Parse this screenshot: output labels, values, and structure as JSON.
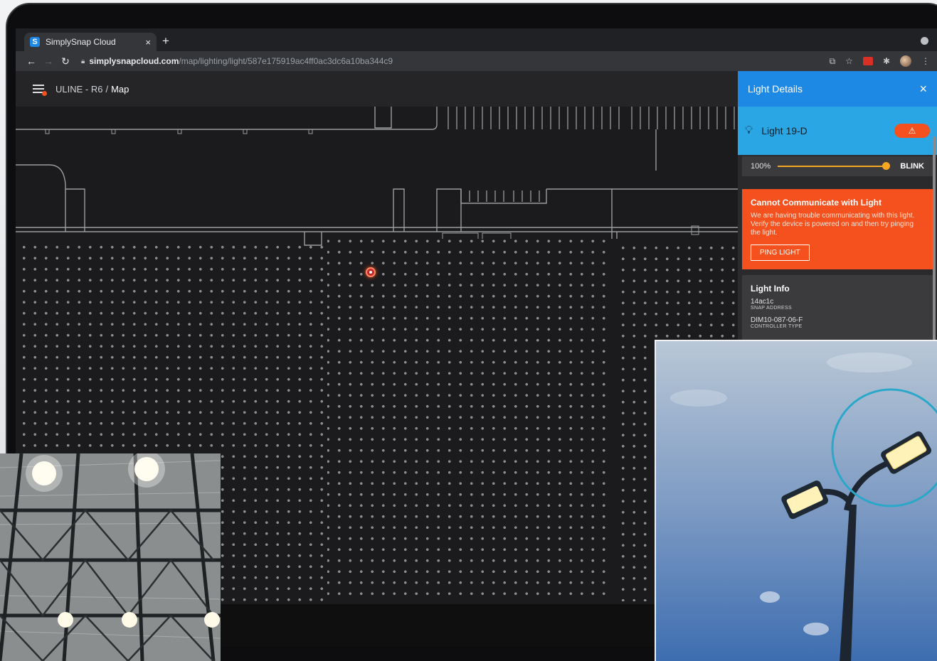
{
  "browser": {
    "tab_title": "SimplySnap Cloud",
    "tab_favicon": "S",
    "tab_close": "×",
    "new_tab": "+",
    "url_host": "simplysnapcloud.com",
    "url_path": "/map/lighting/light/587e175919ac4ff0ac3dc6a10ba344c9",
    "ext_badge": "1"
  },
  "app": {
    "site": "ULINE - R6",
    "separator": "/",
    "page": "Map"
  },
  "panel": {
    "title": "Light Details",
    "close": "×",
    "light_name": "Light 19-D",
    "dim_level": "100%",
    "dim_fraction": 1.0,
    "blink_label": "BLINK",
    "alert_title": "Cannot Communicate with Light",
    "alert_body": "We are having trouble communicating with this light. Verify the device is powered on and then try pinging the light.",
    "ping_label": "PING LIGHT",
    "info_title": "Light Info",
    "snap_address": "14ac1c",
    "snap_address_label": "SNAP ADDRESS",
    "controller_type": "DIM10-087-06-F",
    "controller_type_label": "CONTROLLER TYPE"
  },
  "colors": {
    "panel_head": "#1e88e5",
    "light_row": "#29a6e3",
    "alert": "#f4511e",
    "slider": "#f5a623"
  }
}
